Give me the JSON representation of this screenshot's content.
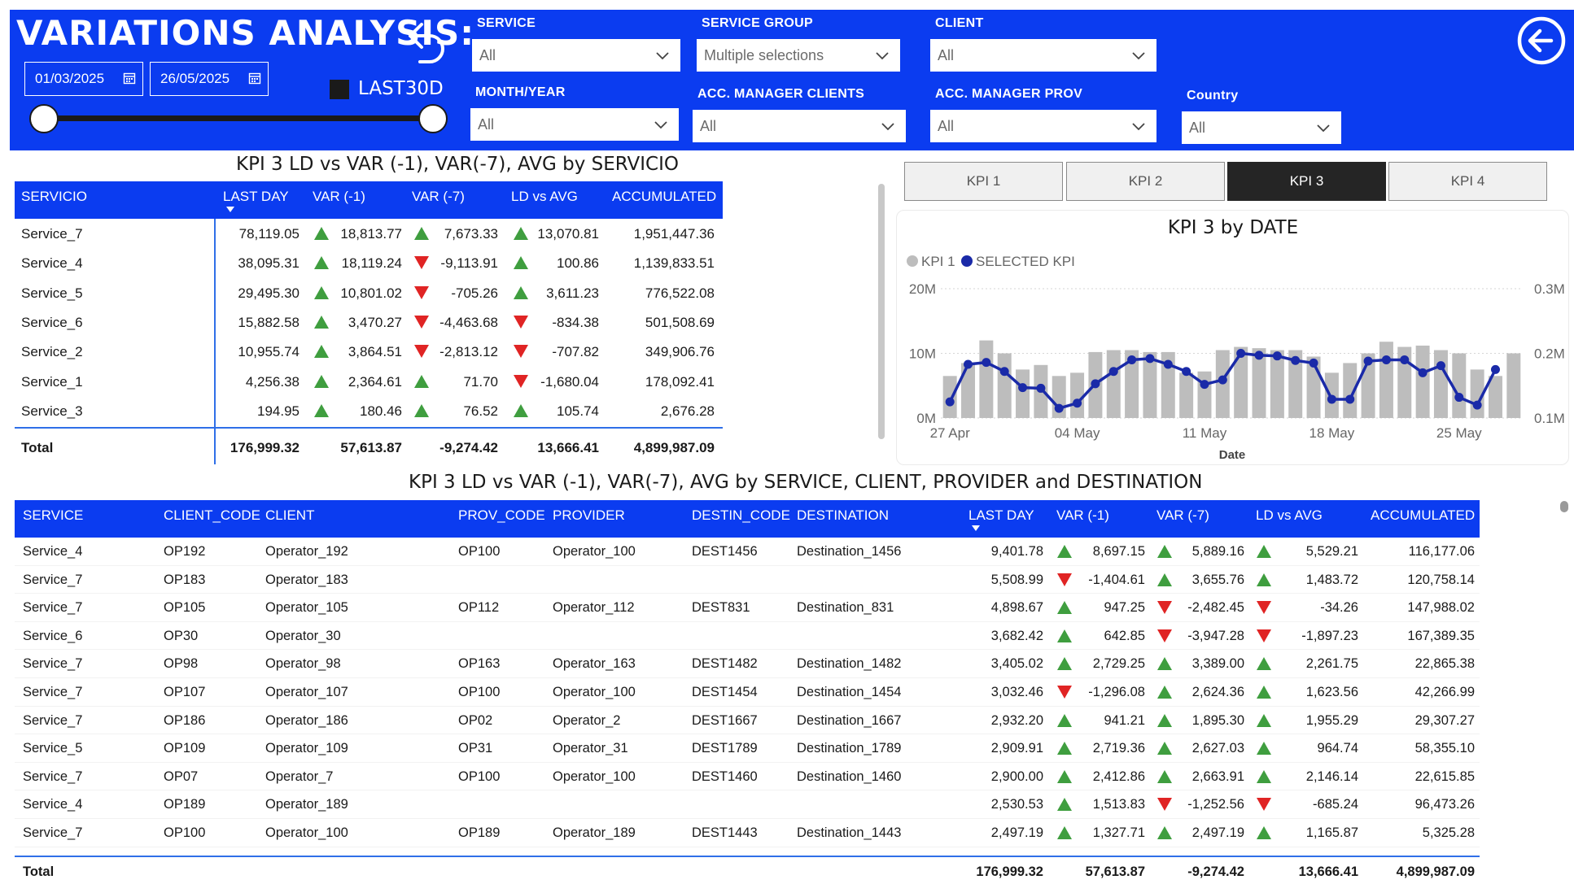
{
  "header": {
    "title": "VARIATIONS ANALYSIS:",
    "date_start": "01/03/2025",
    "date_end": "26/05/2025",
    "last30_label": "LAST30D"
  },
  "filters": [
    {
      "id": "service",
      "label": "SERVICE",
      "value": "All"
    },
    {
      "id": "service-group",
      "label": "SERVICE GROUP",
      "value": "Multiple selections"
    },
    {
      "id": "client",
      "label": "CLIENT",
      "value": "All"
    },
    {
      "id": "month-year",
      "label": "MONTH/YEAR",
      "value": "All"
    },
    {
      "id": "acc-manager-clients",
      "label": "ACC. MANAGER CLIENTS",
      "value": "All"
    },
    {
      "id": "acc-manager-prov",
      "label": "ACC. MANAGER PROV",
      "value": "All"
    },
    {
      "id": "country",
      "label": "Country",
      "value": "All"
    }
  ],
  "table1": {
    "title": "KPI 3 LD vs VAR (-1), VAR(-7), AVG by SERVICIO",
    "columns": [
      "SERVICIO",
      "LAST DAY",
      "VAR (-1)",
      "VAR (-7)",
      "LD vs AVG",
      "ACCUMULATED"
    ],
    "rows": [
      {
        "servicio": "Service_7",
        "last_day": "78,119.05",
        "var1": "18,813.77",
        "var1_dir": "up",
        "var7": "7,673.33",
        "var7_dir": "up",
        "ldavg": "13,070.81",
        "ldavg_dir": "up",
        "acc": "1,951,447.36"
      },
      {
        "servicio": "Service_4",
        "last_day": "38,095.31",
        "var1": "18,119.24",
        "var1_dir": "up",
        "var7": "-9,113.91",
        "var7_dir": "down",
        "ldavg": "100.86",
        "ldavg_dir": "up",
        "acc": "1,139,833.51"
      },
      {
        "servicio": "Service_5",
        "last_day": "29,495.30",
        "var1": "10,801.02",
        "var1_dir": "up",
        "var7": "-705.26",
        "var7_dir": "down",
        "ldavg": "3,611.23",
        "ldavg_dir": "up",
        "acc": "776,522.08"
      },
      {
        "servicio": "Service_6",
        "last_day": "15,882.58",
        "var1": "3,470.27",
        "var1_dir": "up",
        "var7": "-4,463.68",
        "var7_dir": "down",
        "ldavg": "-834.38",
        "ldavg_dir": "down",
        "acc": "501,508.69"
      },
      {
        "servicio": "Service_2",
        "last_day": "10,955.74",
        "var1": "3,864.51",
        "var1_dir": "up",
        "var7": "-2,813.12",
        "var7_dir": "down",
        "ldavg": "-707.82",
        "ldavg_dir": "down",
        "acc": "349,906.76"
      },
      {
        "servicio": "Service_1",
        "last_day": "4,256.38",
        "var1": "2,364.61",
        "var1_dir": "up",
        "var7": "71.70",
        "var7_dir": "up",
        "ldavg": "-1,680.04",
        "ldavg_dir": "down",
        "acc": "178,092.41"
      },
      {
        "servicio": "Service_3",
        "last_day": "194.95",
        "var1": "180.46",
        "var1_dir": "up",
        "var7": "76.52",
        "var7_dir": "up",
        "ldavg": "105.74",
        "ldavg_dir": "up",
        "acc": "2,676.28"
      }
    ],
    "total": {
      "label": "Total",
      "last_day": "176,999.32",
      "var1": "57,613.87",
      "var7": "-9,274.42",
      "ldavg": "13,666.41",
      "acc": "4,899,987.09"
    }
  },
  "kpi_buttons": [
    {
      "label": "KPI 1",
      "active": false
    },
    {
      "label": "KPI 2",
      "active": false
    },
    {
      "label": "KPI 3",
      "active": true
    },
    {
      "label": "KPI 4",
      "active": false
    }
  ],
  "chart_data": {
    "type": "bar",
    "title": "KPI 3 by DATE",
    "xlabel": "Date",
    "legend": [
      {
        "name": "KPI 1",
        "color": "#bdbdbd"
      },
      {
        "name": "SELECTED KPI",
        "color": "#1a2aa8"
      }
    ],
    "legend_position": "top-left",
    "x_ticks": [
      "27 Apr",
      "04 May",
      "11 May",
      "18 May",
      "25 May"
    ],
    "ylim_left": [
      0,
      20000000
    ],
    "y_ticks_left": [
      "0M",
      "10M",
      "20M"
    ],
    "ylim_right": [
      0.1,
      0.3
    ],
    "y_ticks_right": [
      "0.1M",
      "0.2M",
      "0.3M"
    ],
    "grid": true,
    "series": [
      {
        "name": "KPI 1",
        "type": "bar",
        "axis": "left",
        "values": [
          6.5,
          8.5,
          12,
          10,
          7.5,
          8.2,
          6.5,
          7,
          10.2,
          10.5,
          10.5,
          10.2,
          10.2,
          7,
          7.2,
          10.5,
          11,
          10.8,
          10.5,
          10.5,
          9.5,
          7,
          8.5,
          10,
          11.8,
          11,
          11.2,
          10.5,
          10,
          7.5,
          6.5,
          10
        ]
      },
      {
        "name": "SELECTED KPI",
        "type": "line",
        "axis": "right",
        "values": [
          0.125,
          0.183,
          0.186,
          0.172,
          0.147,
          0.146,
          0.115,
          0.123,
          0.153,
          0.172,
          0.19,
          0.192,
          0.183,
          0.172,
          0.152,
          0.159,
          0.2,
          0.197,
          0.196,
          0.189,
          0.185,
          0.129,
          0.129,
          0.188,
          0.19,
          0.19,
          0.17,
          0.181,
          0.132,
          0.12,
          0.175
        ]
      }
    ]
  },
  "table2": {
    "title": "KPI 3 LD vs VAR (-1), VAR(-7), AVG by SERVICE, CLIENT, PROVIDER and DESTINATION",
    "columns": [
      "SERVICE",
      "CLIENT_CODE",
      "CLIENT",
      "PROV_CODE",
      "PROVIDER",
      "DESTIN_CODE",
      "DESTINATION",
      "LAST DAY",
      "VAR (-1)",
      "VAR (-7)",
      "LD vs AVG",
      "ACCUMULATED"
    ],
    "rows": [
      {
        "service": "Service_4",
        "client_code": "OP192",
        "client": "Operator_192",
        "prov_code": "OP100",
        "provider": "Operator_100",
        "destin_code": "DEST1456",
        "destination": "Destination_1456",
        "last_day": "9,401.78",
        "var1": "8,697.15",
        "var1_dir": "up",
        "var7": "5,889.16",
        "var7_dir": "up",
        "ldavg": "5,529.21",
        "ldavg_dir": "up",
        "acc": "116,177.06"
      },
      {
        "service": "Service_7",
        "client_code": "OP183",
        "client": "Operator_183",
        "prov_code": "",
        "provider": "",
        "destin_code": "",
        "destination": "",
        "last_day": "5,508.99",
        "var1": "-1,404.61",
        "var1_dir": "down",
        "var7": "3,655.76",
        "var7_dir": "up",
        "ldavg": "1,483.72",
        "ldavg_dir": "up",
        "acc": "120,758.14"
      },
      {
        "service": "Service_7",
        "client_code": "OP105",
        "client": "Operator_105",
        "prov_code": "OP112",
        "provider": "Operator_112",
        "destin_code": "DEST831",
        "destination": "Destination_831",
        "last_day": "4,898.67",
        "var1": "947.25",
        "var1_dir": "up",
        "var7": "-2,482.45",
        "var7_dir": "down",
        "ldavg": "-34.26",
        "ldavg_dir": "down",
        "acc": "147,988.02"
      },
      {
        "service": "Service_6",
        "client_code": "OP30",
        "client": "Operator_30",
        "prov_code": "",
        "provider": "",
        "destin_code": "",
        "destination": "",
        "last_day": "3,682.42",
        "var1": "642.85",
        "var1_dir": "up",
        "var7": "-3,947.28",
        "var7_dir": "down",
        "ldavg": "-1,897.23",
        "ldavg_dir": "down",
        "acc": "167,389.35"
      },
      {
        "service": "Service_7",
        "client_code": "OP98",
        "client": "Operator_98",
        "prov_code": "OP163",
        "provider": "Operator_163",
        "destin_code": "DEST1482",
        "destination": "Destination_1482",
        "last_day": "3,405.02",
        "var1": "2,729.25",
        "var1_dir": "up",
        "var7": "3,389.00",
        "var7_dir": "up",
        "ldavg": "2,261.75",
        "ldavg_dir": "up",
        "acc": "22,865.38"
      },
      {
        "service": "Service_7",
        "client_code": "OP107",
        "client": "Operator_107",
        "prov_code": "OP100",
        "provider": "Operator_100",
        "destin_code": "DEST1454",
        "destination": "Destination_1454",
        "last_day": "3,032.46",
        "var1": "-1,296.08",
        "var1_dir": "down",
        "var7": "2,624.36",
        "var7_dir": "up",
        "ldavg": "1,623.56",
        "ldavg_dir": "up",
        "acc": "42,266.99"
      },
      {
        "service": "Service_7",
        "client_code": "OP186",
        "client": "Operator_186",
        "prov_code": "OP02",
        "provider": "Operator_2",
        "destin_code": "DEST1667",
        "destination": "Destination_1667",
        "last_day": "2,932.20",
        "var1": "941.21",
        "var1_dir": "up",
        "var7": "1,895.30",
        "var7_dir": "up",
        "ldavg": "1,955.29",
        "ldavg_dir": "up",
        "acc": "29,307.27"
      },
      {
        "service": "Service_5",
        "client_code": "OP109",
        "client": "Operator_109",
        "prov_code": "OP31",
        "provider": "Operator_31",
        "destin_code": "DEST1789",
        "destination": "Destination_1789",
        "last_day": "2,909.91",
        "var1": "2,719.36",
        "var1_dir": "up",
        "var7": "2,627.03",
        "var7_dir": "up",
        "ldavg": "964.74",
        "ldavg_dir": "up",
        "acc": "58,355.10"
      },
      {
        "service": "Service_7",
        "client_code": "OP07",
        "client": "Operator_7",
        "prov_code": "OP100",
        "provider": "Operator_100",
        "destin_code": "DEST1460",
        "destination": "Destination_1460",
        "last_day": "2,900.00",
        "var1": "2,412.86",
        "var1_dir": "up",
        "var7": "2,663.91",
        "var7_dir": "up",
        "ldavg": "2,146.14",
        "ldavg_dir": "up",
        "acc": "22,615.85"
      },
      {
        "service": "Service_4",
        "client_code": "OP189",
        "client": "Operator_189",
        "prov_code": "",
        "provider": "",
        "destin_code": "",
        "destination": "",
        "last_day": "2,530.53",
        "var1": "1,513.83",
        "var1_dir": "up",
        "var7": "-1,252.56",
        "var7_dir": "down",
        "ldavg": "-685.24",
        "ldavg_dir": "down",
        "acc": "96,473.26"
      },
      {
        "service": "Service_7",
        "client_code": "OP100",
        "client": "Operator_100",
        "prov_code": "OP189",
        "provider": "Operator_189",
        "destin_code": "DEST1443",
        "destination": "Destination_1443",
        "last_day": "2,497.19",
        "var1": "1,327.71",
        "var1_dir": "up",
        "var7": "2,497.19",
        "var7_dir": "up",
        "ldavg": "1,165.87",
        "ldavg_dir": "up",
        "acc": "5,325.28"
      }
    ],
    "total": {
      "label": "Total",
      "last_day": "176,999.32",
      "var1": "57,613.87",
      "var7": "-9,274.42",
      "ldavg": "13,666.41",
      "acc": "4,899,987.09"
    }
  },
  "colors": {
    "brand_blue": "#0b3cf0",
    "up_green": "#3f9e3f",
    "down_red": "#e02424",
    "line_navy": "#1a2aa8",
    "bar_gray": "#bdbdbd"
  },
  "icons": {
    "undo": "undo-arrow-icon",
    "back": "back-arrow-circle-icon",
    "calendar": "calendar-icon",
    "chevron": "chevron-down-icon",
    "up": "triangle-up-icon",
    "down": "triangle-down-icon"
  }
}
